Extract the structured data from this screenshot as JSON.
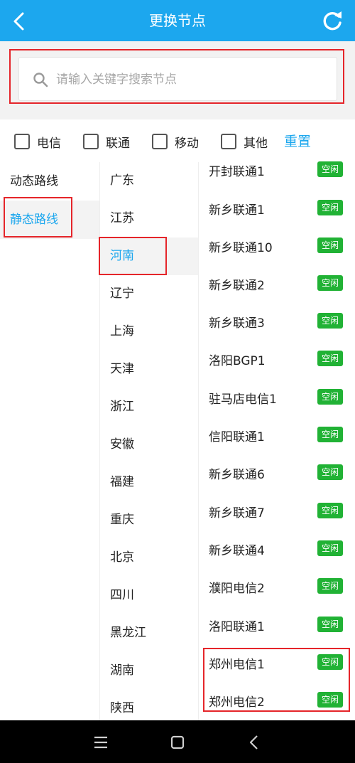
{
  "header": {
    "title": "更换节点",
    "back_icon": "chevron-left-icon",
    "refresh_icon": "refresh-icon"
  },
  "search": {
    "placeholder": "请输入关键字搜索节点",
    "value": ""
  },
  "filters": [
    {
      "label": "电信",
      "checked": false
    },
    {
      "label": "联通",
      "checked": false
    },
    {
      "label": "移动",
      "checked": false
    },
    {
      "label": "其他",
      "checked": false
    }
  ],
  "reset_label": "重置",
  "route_types": [
    {
      "label": "动态路线",
      "active": false
    },
    {
      "label": "静态路线",
      "active": true
    }
  ],
  "provinces": [
    {
      "label": "广东",
      "active": false
    },
    {
      "label": "江苏",
      "active": false
    },
    {
      "label": "河南",
      "active": true
    },
    {
      "label": "辽宁",
      "active": false
    },
    {
      "label": "上海",
      "active": false
    },
    {
      "label": "天津",
      "active": false
    },
    {
      "label": "浙江",
      "active": false
    },
    {
      "label": "安徽",
      "active": false
    },
    {
      "label": "福建",
      "active": false
    },
    {
      "label": "重庆",
      "active": false
    },
    {
      "label": "北京",
      "active": false
    },
    {
      "label": "四川",
      "active": false
    },
    {
      "label": "黑龙江",
      "active": false
    },
    {
      "label": "湖南",
      "active": false
    },
    {
      "label": "陕西",
      "active": false
    }
  ],
  "nodes": [
    {
      "name": "开封联通1",
      "status": "空闲"
    },
    {
      "name": "新乡联通1",
      "status": "空闲"
    },
    {
      "name": "新乡联通10",
      "status": "空闲"
    },
    {
      "name": "新乡联通2",
      "status": "空闲"
    },
    {
      "name": "新乡联通3",
      "status": "空闲"
    },
    {
      "name": "洛阳BGP1",
      "status": "空闲"
    },
    {
      "name": "驻马店电信1",
      "status": "空闲"
    },
    {
      "name": "信阳联通1",
      "status": "空闲"
    },
    {
      "name": "新乡联通6",
      "status": "空闲"
    },
    {
      "name": "新乡联通7",
      "status": "空闲"
    },
    {
      "name": "新乡联通4",
      "status": "空闲"
    },
    {
      "name": "濮阳电信2",
      "status": "空闲"
    },
    {
      "name": "洛阳联通1",
      "status": "空闲"
    },
    {
      "name": "郑州电信1",
      "status": "空闲"
    },
    {
      "name": "郑州电信2",
      "status": "空闲"
    }
  ],
  "colors": {
    "accent": "#1ca7ee",
    "badge": "#21b235",
    "highlight": "#e5252a"
  },
  "navbar": {
    "icons": [
      "menu-icon",
      "home-square-icon",
      "back-triangle-icon"
    ]
  }
}
